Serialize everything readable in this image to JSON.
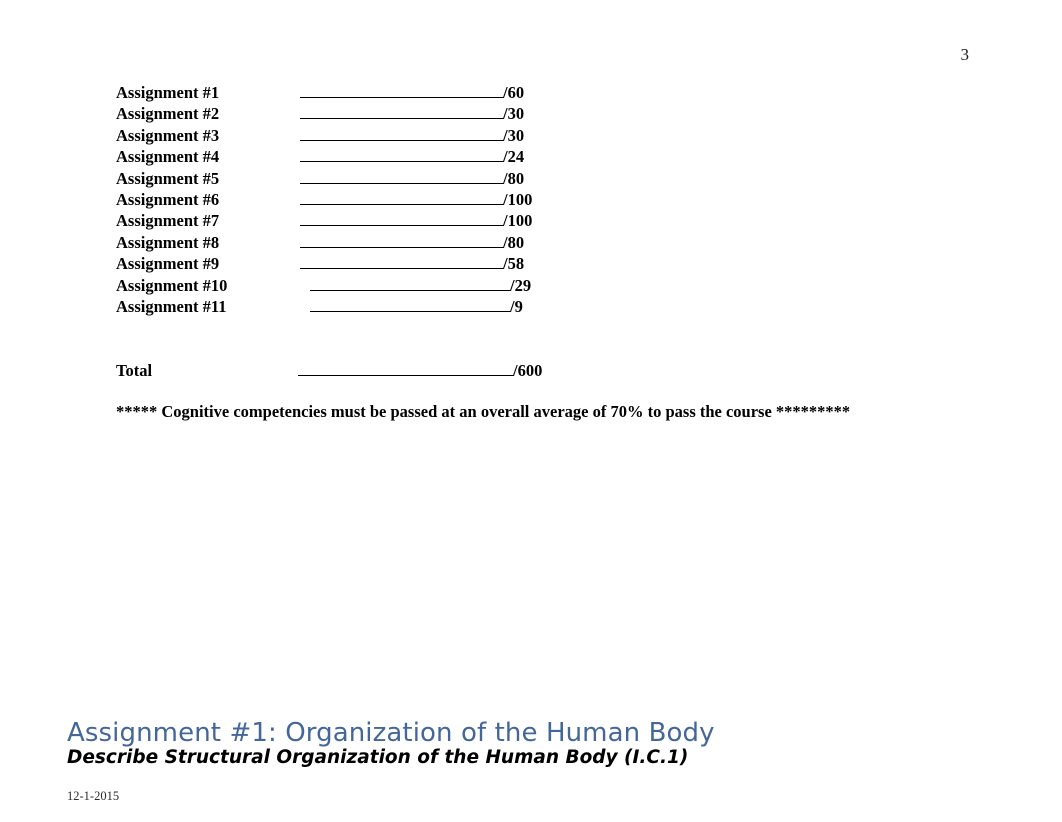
{
  "document": {
    "page_number": "3",
    "footer_date": "12-1-2015"
  },
  "grade_table": {
    "rows": [
      {
        "label": "Assignment #1",
        "blank": "",
        "points": "/60",
        "indent": false
      },
      {
        "label": "Assignment #2",
        "blank": "",
        "points": "/30",
        "indent": false
      },
      {
        "label": "Assignment #3",
        "blank": "",
        "points": "/30",
        "indent": false
      },
      {
        "label": "Assignment #4",
        "blank": "",
        "points": "/24",
        "indent": false
      },
      {
        "label": "Assignment #5",
        "blank": "",
        "points": "/80",
        "indent": false
      },
      {
        "label": "Assignment #6",
        "blank": "",
        "points": "/100",
        "indent": false
      },
      {
        "label": "Assignment #7",
        "blank": "",
        "points": "/100",
        "indent": false
      },
      {
        "label": "Assignment #8",
        "blank": "",
        "points": "/80",
        "indent": false
      },
      {
        "label": "Assignment #9",
        "blank": "",
        "points": "/58",
        "indent": false
      },
      {
        "label": "Assignment #10",
        "blank": "",
        "points": "/29",
        "indent": true
      },
      {
        "label": "Assignment #11",
        "blank": "",
        "points": "/9",
        "indent": true
      }
    ],
    "total": {
      "label": "Total",
      "blank": "",
      "points": "/600"
    }
  },
  "note": {
    "text": "***** Cognitive competencies must be passed at an overall average of 70% to pass the course *********"
  },
  "assignment_section": {
    "heading": "Assignment #1: Organization of the Human Body",
    "subheading": "Describe Structural Organization of the Human Body (I.C.1)",
    "heading_color": "#44679B"
  }
}
